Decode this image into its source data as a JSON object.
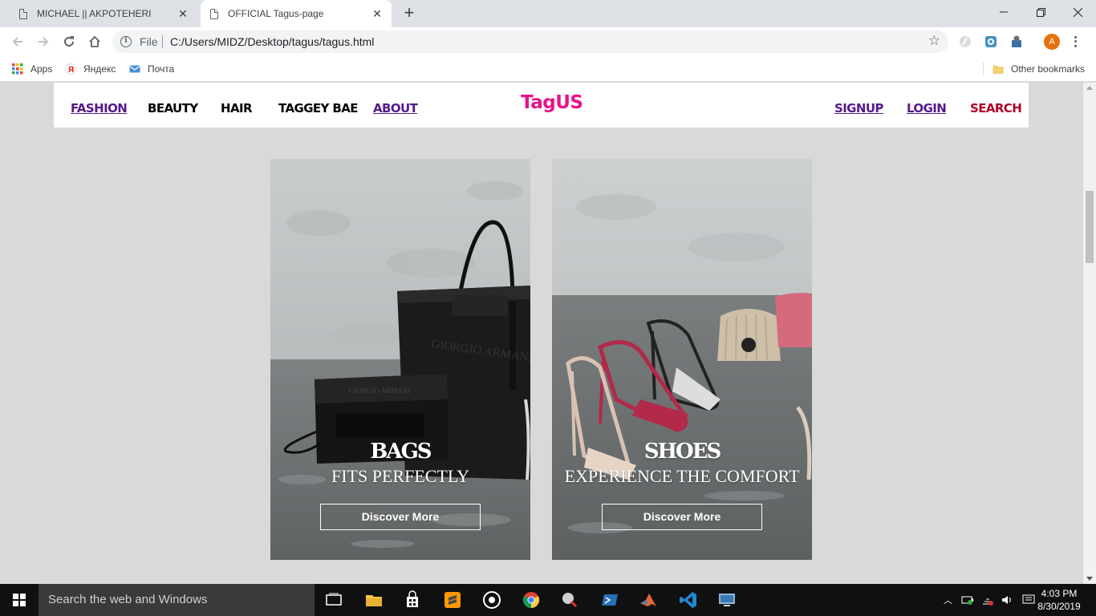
{
  "browser": {
    "tabs": [
      {
        "title": "MICHAEL || AKPOTEHERI",
        "active": false
      },
      {
        "title": "OFFICIAL Tagus-page",
        "active": true
      }
    ],
    "omnibox": {
      "scheme_label": "File",
      "url": "C:/Users/MIDZ/Desktop/tagus/tagus.html"
    },
    "bookmarks": [
      {
        "label": "Apps"
      },
      {
        "label": "Яндекс"
      },
      {
        "label": "Почта"
      }
    ],
    "other_bookmarks": "Other bookmarks",
    "profile_initial": "A"
  },
  "site": {
    "logo": "TagUS",
    "nav_left": [
      "FASHION",
      "BEAUTY",
      "HAIR",
      "TAGGEY BAE",
      "ABOUT"
    ],
    "nav_right": [
      "SIGNUP",
      "LOGIN",
      "SEARCH"
    ],
    "cards": [
      {
        "heading": "BAGS",
        "subheading": "FITS PERFECTLY",
        "cta": "Discover More"
      },
      {
        "heading": "SHOES",
        "subheading": "EXPERIENCE THE COMFORT",
        "cta": "Discover More"
      }
    ],
    "colors": {
      "logo": "#e8128a",
      "visited_link": "#551a8b",
      "search": "#b0002a",
      "background": "#d9d9d9"
    }
  },
  "taskbar": {
    "search_placeholder": "Search the web and Windows",
    "time": "4:03 PM",
    "date": "8/30/2019"
  }
}
